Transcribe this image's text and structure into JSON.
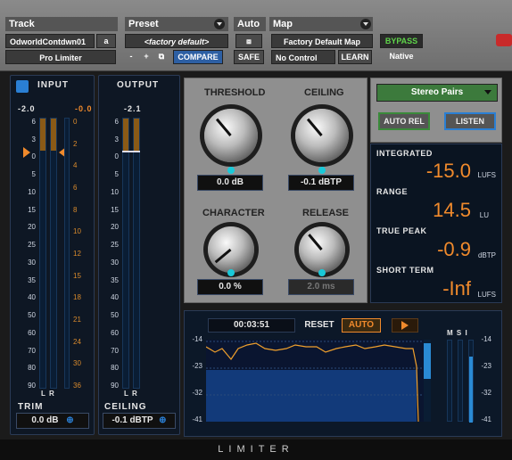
{
  "topbar": {
    "track_header": "Track",
    "preset_header": "Preset",
    "auto_header": "Auto",
    "map_header": "Map",
    "track_name": "OdworldContdwn01",
    "track_suffix": "a",
    "plugin_name": "Pro Limiter",
    "preset_value": "<factory default>",
    "minus": "-",
    "plus": "+",
    "compare": "COMPARE",
    "safe": "SAFE",
    "map_value": "Factory Default Map",
    "no_control": "No Control",
    "learn": "LEARN",
    "bypass": "BYPASS",
    "native": "Native"
  },
  "input_meter": {
    "label": "INPUT",
    "peak_left": "-2.0",
    "peak_right": "-0.0",
    "scale": [
      "6",
      "3",
      "0",
      "5",
      "10",
      "15",
      "20",
      "25",
      "30",
      "35",
      "40",
      "50",
      "60",
      "70",
      "80",
      "90"
    ],
    "gr_scale": [
      "0",
      "2",
      "4",
      "6",
      "8",
      "10",
      "12",
      "15",
      "18",
      "21",
      "24",
      "30",
      "36"
    ],
    "lr": "L  R",
    "trim_label": "TRIM",
    "trim_value": "0.0 dB"
  },
  "output_meter": {
    "label": "OUTPUT",
    "peak": "-2.1",
    "scale": [
      "6",
      "3",
      "0",
      "5",
      "10",
      "15",
      "20",
      "25",
      "30",
      "35",
      "40",
      "50",
      "60",
      "70",
      "80",
      "90"
    ],
    "lr": "L  R",
    "ceiling_label": "CEILING",
    "ceiling_value": "-0.1 dBTP"
  },
  "knobs": {
    "threshold": {
      "label": "THRESHOLD",
      "value": "0.0 dB"
    },
    "ceiling": {
      "label": "CEILING",
      "value": "-0.1 dBTP"
    },
    "character": {
      "label": "CHARACTER",
      "value": "0.0 %"
    },
    "release": {
      "label": "RELEASE",
      "value": "2.0 ms"
    }
  },
  "controls": {
    "mode": "Stereo Pairs",
    "auto_rel": "AUTO REL",
    "listen": "LISTEN"
  },
  "loudness": {
    "integrated_label": "INTEGRATED",
    "integrated_value": "-15.0",
    "integrated_unit": "LUFS",
    "range_label": "RANGE",
    "range_value": "14.5",
    "range_unit": "LU",
    "true_peak_label": "TRUE PEAK",
    "true_peak_value": "-0.9",
    "true_peak_unit": "dBTP",
    "short_term_label": "SHORT TERM",
    "short_term_value": "-Inf",
    "short_term_unit": "LUFS"
  },
  "history": {
    "time": "00:03:51",
    "reset": "RESET",
    "auto": "AUTO",
    "y_labels": [
      "-14",
      "-23",
      "-32",
      "-41"
    ],
    "right_y_labels": [
      "-14",
      "-23",
      "-32",
      "-41"
    ],
    "msi": "M  S  I"
  },
  "footer": "LIMITER",
  "colors": {
    "accent": "#f08a2c",
    "cyan": "#19c9d9",
    "bypass_green": "#5fd44a"
  }
}
